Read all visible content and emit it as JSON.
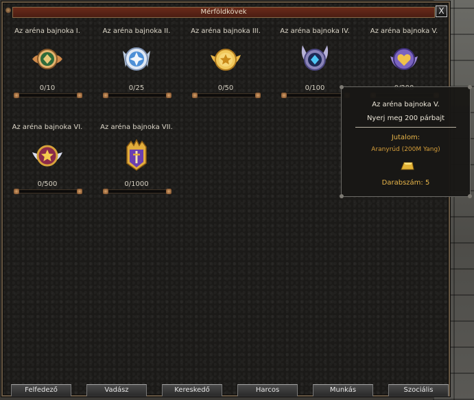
{
  "window": {
    "title": "Mérföldkövek",
    "close_label": "X"
  },
  "milestones": [
    {
      "label": "Az aréna bajnoka I.",
      "progress": "0/10",
      "fraction": 0,
      "icon": "green-diamond-badge-icon"
    },
    {
      "label": "Az aréna bajnoka II.",
      "progress": "0/25",
      "fraction": 0,
      "icon": "blue-star-badge-icon"
    },
    {
      "label": "Az aréna bajnoka III.",
      "progress": "0/50",
      "fraction": 0,
      "icon": "gold-star-badge-icon"
    },
    {
      "label": "Az aréna bajnoka IV.",
      "progress": "0/100",
      "fraction": 0,
      "icon": "blue-gem-badge-icon"
    },
    {
      "label": "Az aréna bajnoka V.",
      "progress": "0/200",
      "fraction": 0,
      "icon": "purple-heart-badge-icon"
    },
    {
      "label": "Az aréna bajnoka VI.",
      "progress": "0/500",
      "fraction": 0,
      "icon": "winged-star-badge-icon"
    },
    {
      "label": "Az aréna bajnoka VII.",
      "progress": "0/1000",
      "fraction": 0,
      "icon": "crown-sword-badge-icon"
    }
  ],
  "tooltip": {
    "title": "Az aréna bajnoka V.",
    "description": "Nyerj meg 200 párbajt",
    "reward_label": "Jutalom:",
    "reward_name": "Aranyrúd (200M Yang)",
    "reward_icon": "gold-bar-icon",
    "count_label": "Darabszám: 5"
  },
  "tabs": [
    "Felfedező",
    "Vadász",
    "Kereskedő",
    "Harcos",
    "Munkás",
    "Szociális"
  ],
  "colors": {
    "title_bar": "#5a2416",
    "reward_text": "#e9b64a",
    "window_bg": "#1b1a18"
  }
}
